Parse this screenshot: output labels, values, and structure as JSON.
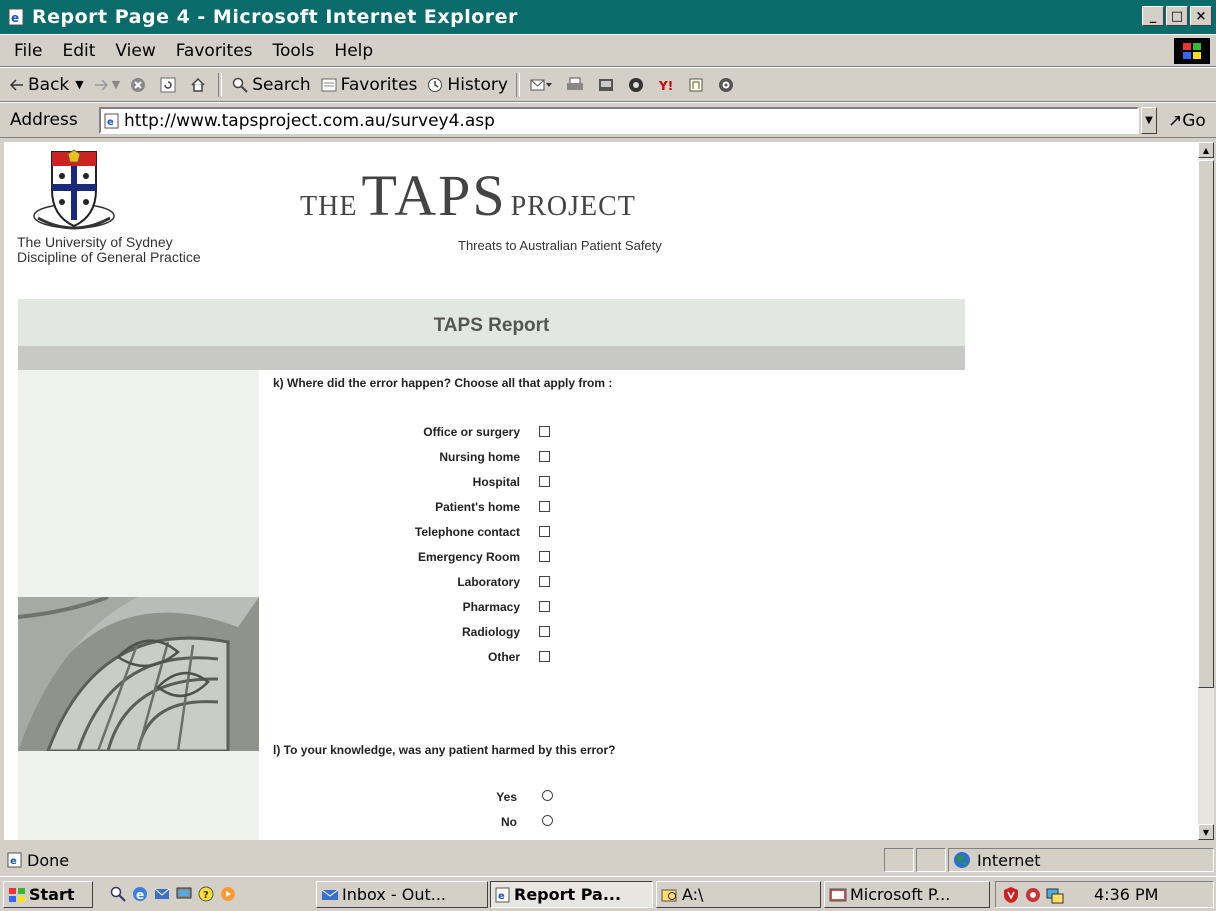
{
  "window": {
    "title": "Report Page 4 - Microsoft Internet Explorer",
    "controls": [
      "_",
      "□",
      "×"
    ]
  },
  "menu": [
    "File",
    "Edit",
    "View",
    "Favorites",
    "Tools",
    "Help"
  ],
  "toolbar": {
    "back": "Back",
    "search": "Search",
    "favorites": "Favorites",
    "history": "History"
  },
  "address": {
    "label": "Address",
    "url": "http://www.tapsproject.com.au/survey4.asp",
    "go": "Go"
  },
  "page": {
    "university_line1": "The University of Sydney",
    "university_line2": "Discipline of General Practice",
    "logo_the": "THE",
    "logo_taps": "TAPS",
    "logo_project": "PROJECT",
    "subtitle": "Threats to Australian Patient Safety",
    "report_title": "TAPS Report",
    "question_k": "k) Where did the error happen? Choose all that apply from :",
    "options_k": [
      "Office or surgery",
      "Nursing home",
      "Hospital",
      "Patient's home",
      "Telephone contact",
      "Emergency Room",
      "Laboratory",
      "Pharmacy",
      "Radiology",
      "Other"
    ],
    "question_l": "l) To your knowledge, was any patient harmed by this error?",
    "options_l": [
      "Yes",
      "No"
    ]
  },
  "status": {
    "text": "Done",
    "zone": "Internet"
  },
  "taskbar": {
    "start": "Start",
    "tasks": [
      "Inbox - Out...",
      "Report Pa...",
      "A:\\",
      "Microsoft P..."
    ],
    "time": "4:36 PM"
  },
  "colors": {
    "titlebar": "#0a6b6b",
    "chrome": "#d4d0c8",
    "report_bar": "#e3e7e1",
    "grey_bar": "#c8c8c6"
  }
}
